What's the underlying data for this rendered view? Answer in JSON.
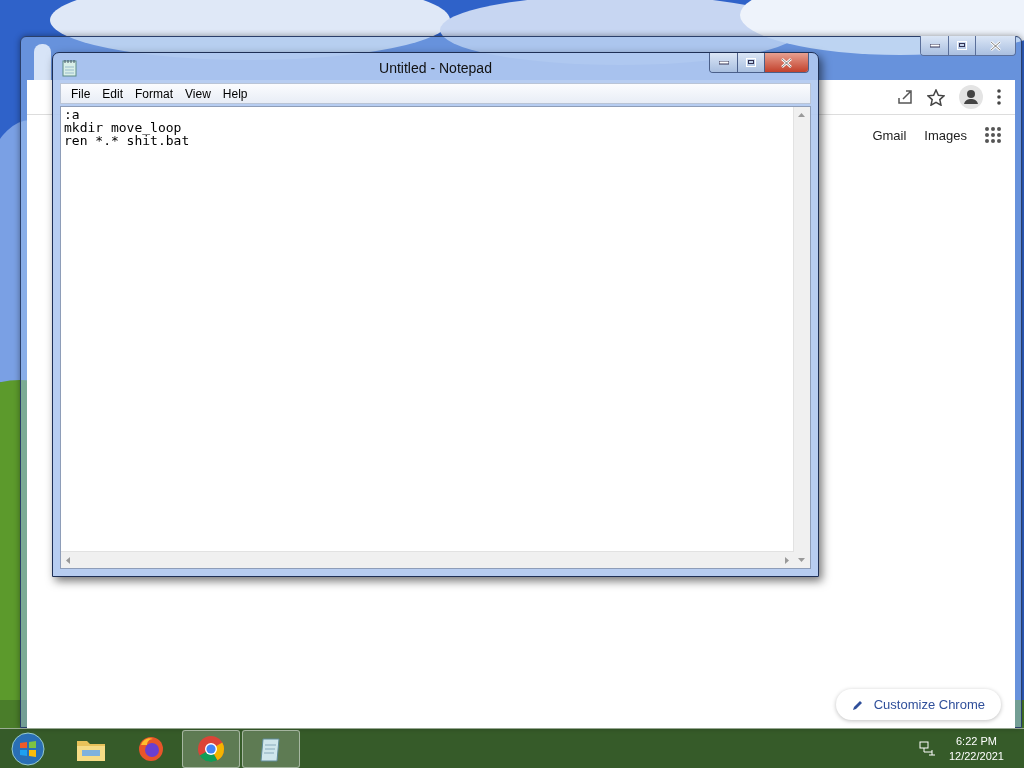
{
  "browser": {
    "links": [
      "Gmail",
      "Images"
    ],
    "customize_button": "Customize Chrome"
  },
  "notepad": {
    "title": "Untitled - Notepad",
    "menu": [
      "File",
      "Edit",
      "Format",
      "View",
      "Help"
    ],
    "lines": [
      ":a",
      "mkdir move_loop",
      "ren *.* shit.bat"
    ]
  },
  "taskbar": {
    "items": [
      {
        "kind": "explorer",
        "running": false
      },
      {
        "kind": "firefox",
        "running": false
      },
      {
        "kind": "chrome",
        "running": true
      },
      {
        "kind": "notepad",
        "running": true
      }
    ],
    "time": "6:22 PM",
    "date": "12/22/2021"
  }
}
